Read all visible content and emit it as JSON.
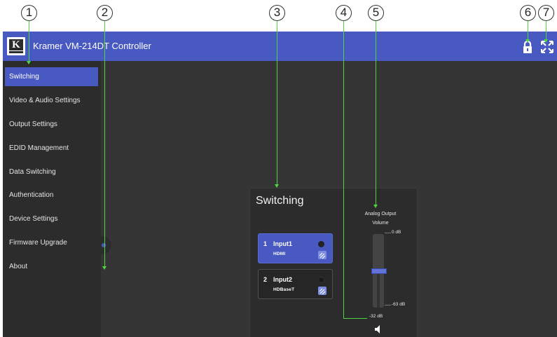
{
  "callouts": [
    "1",
    "2",
    "3",
    "4",
    "5",
    "6",
    "7"
  ],
  "header": {
    "logo_letter": "K",
    "title": "Kramer VM-214DT Controller",
    "lock_icon": "lock-icon",
    "fullscreen_icon": "fullscreen-icon"
  },
  "sidebar": {
    "items": [
      {
        "label": "Switching",
        "active": true
      },
      {
        "label": "Video & Audio Settings",
        "active": false
      },
      {
        "label": "Output Settings",
        "active": false
      },
      {
        "label": "EDID Management",
        "active": false
      },
      {
        "label": "Data Switching",
        "active": false
      },
      {
        "label": "Authentication",
        "active": false
      },
      {
        "label": "Device Settings",
        "active": false
      },
      {
        "label": "Firmware Upgrade",
        "active": false
      },
      {
        "label": "About",
        "active": false
      }
    ]
  },
  "switching": {
    "title": "Switching",
    "inputs": [
      {
        "number": "1",
        "name": "Input1",
        "type": "HDMI",
        "selected": true
      },
      {
        "number": "2",
        "name": "Input2",
        "type": "HDBaseT",
        "selected": false
      }
    ],
    "volume": {
      "label_line1": "Analog Output",
      "label_line2": "Volume",
      "max_label": "0 dB",
      "min_label": "-63 dB",
      "current": "-32 dB",
      "level_db": -32,
      "min_db": -63,
      "max_db": 0
    }
  },
  "colors": {
    "accent": "#4959c2",
    "background": "#353535",
    "sidebar": "#2c2c2c",
    "callout_line": "#4ed641"
  }
}
